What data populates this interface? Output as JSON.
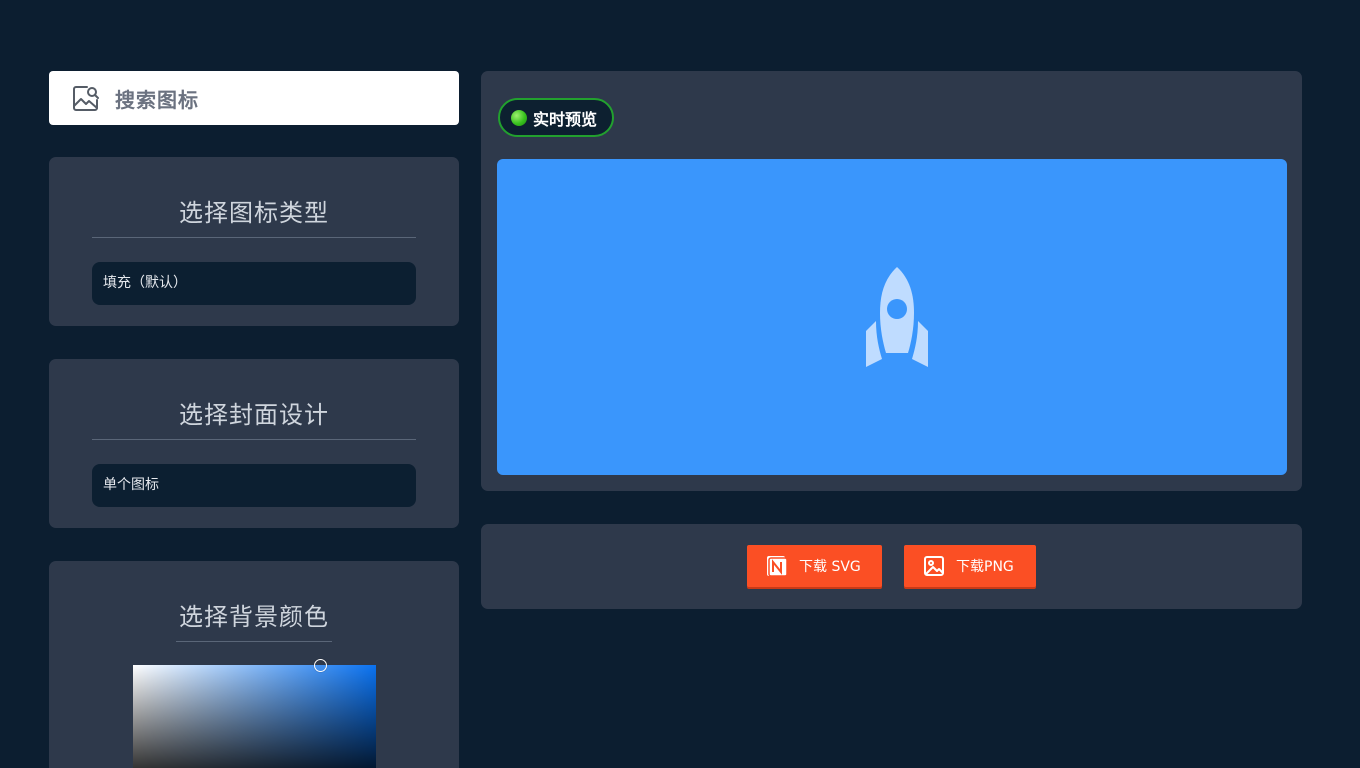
{
  "search": {
    "label": "搜索图标"
  },
  "icon_type": {
    "title": "选择图标类型",
    "selected": "填充（默认）"
  },
  "cover_design": {
    "title": "选择封面设计",
    "selected": "单个图标"
  },
  "background_color": {
    "title": "选择背景颜色",
    "picker_hue": "#0a72f0"
  },
  "preview": {
    "badge_label": "实时预览",
    "canvas_color": "#3a96fc",
    "icon": "rocket-icon",
    "icon_color": "#bfdcff"
  },
  "downloads": {
    "svg_label": "下载 SVG",
    "svg_icon": "notion-icon",
    "png_label": "下载PNG",
    "png_icon": "image-icon",
    "button_color": "#fb4f24"
  }
}
